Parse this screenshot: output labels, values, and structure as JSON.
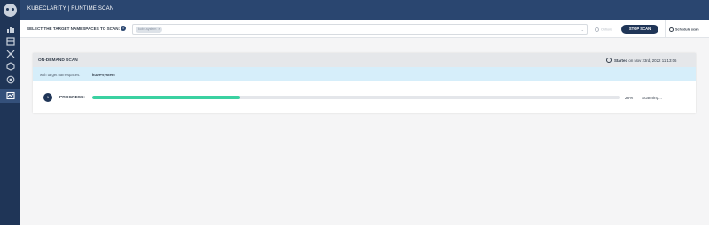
{
  "header": {
    "title": "KUBECLARITY | RUNTIME SCAN"
  },
  "toolbar": {
    "select_label": "SELECT THE TARGET NAMESPACES TO SCAN:",
    "info_icon": "i",
    "selected_namespace": "kube-system",
    "chip_remove": "×",
    "options_label": "Options",
    "stop_button": "STOP SCAN",
    "schedule_label": "Schedule scan"
  },
  "scan": {
    "title": "ON-DEMAND SCAN",
    "started_label": "Started",
    "started_time": "on Nov 23rd, 2022 11:13:06",
    "target_label": "with target namespaces:",
    "target_value": "kube-system",
    "step_number": "1",
    "progress_label": "PROGRESS:",
    "progress_value": 28,
    "progress_text": "28%",
    "status": "Scanning..."
  },
  "colors": {
    "sidebar": "#1f3557",
    "topbar": "#2a4670",
    "progress_fill": "#3bd1a1",
    "target_row_bg": "#d6eefa"
  },
  "sidebar_icons": [
    "dashboard-icon",
    "applications-icon",
    "resources-icon",
    "packages-icon",
    "vulnerabilities-icon",
    "runtime-scan-icon"
  ]
}
